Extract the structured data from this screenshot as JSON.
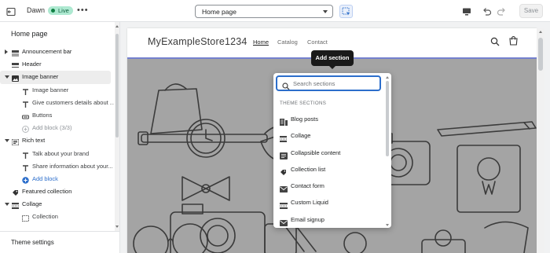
{
  "topbar": {
    "exit_icon": "exit-icon",
    "theme_name": "Dawn",
    "status_badge": "Live",
    "more_icon": "more-icon",
    "more_text": "•••",
    "page_selector": "Home page",
    "inspector_icon": "inspector-icon",
    "device_icon": "desktop-icon",
    "undo_icon": "undo-icon",
    "redo_icon": "redo-icon",
    "save_label": "Save"
  },
  "sidebar": {
    "title": "Home page",
    "items": [
      {
        "label": "Announcement bar",
        "level": 0,
        "arrow": "right",
        "icon": "announcement-icon"
      },
      {
        "label": "Header",
        "level": 0,
        "arrow": "",
        "icon": "header-icon"
      },
      {
        "label": "Image banner",
        "level": 0,
        "arrow": "down",
        "icon": "image-icon",
        "selected": true
      },
      {
        "label": "Image banner",
        "level": 1,
        "icon": "text-icon"
      },
      {
        "label": "Give customers details about ...",
        "level": 1,
        "icon": "text-icon"
      },
      {
        "label": "Buttons",
        "level": 1,
        "icon": "buttons-icon"
      },
      {
        "label": "Add block (3/3)",
        "level": 1,
        "icon": "add-disabled-icon",
        "muted": true
      },
      {
        "label": "Rich text",
        "level": 0,
        "arrow": "down",
        "icon": "rich-text-icon"
      },
      {
        "label": "Talk about your brand",
        "level": 1,
        "icon": "text-icon"
      },
      {
        "label": "Share information about your...",
        "level": 1,
        "icon": "text-icon"
      },
      {
        "label": "Add block",
        "level": 1,
        "icon": "add-icon",
        "link": true
      },
      {
        "label": "Featured collection",
        "level": 0,
        "arrow": "",
        "icon": "collection-tag-icon"
      },
      {
        "label": "Collage",
        "level": 0,
        "arrow": "down",
        "icon": "collage-icon"
      },
      {
        "label": "Collection",
        "level": 1,
        "icon": "collage-item-icon"
      }
    ],
    "footer_label": "Theme settings"
  },
  "preview": {
    "store_name": "MyExampleStore1234",
    "nav": [
      "Home",
      "Catalog",
      "Contact"
    ],
    "search_icon": "search-icon",
    "cart_icon": "cart-icon"
  },
  "tooltip": "Add section",
  "popup": {
    "search_placeholder": "Search sections",
    "search_value": "",
    "heading": "THEME SECTIONS",
    "items": [
      {
        "label": "Blog posts",
        "icon": "blog-icon"
      },
      {
        "label": "Collage",
        "icon": "collage-icon"
      },
      {
        "label": "Collapsible content",
        "icon": "collapsible-icon"
      },
      {
        "label": "Collection list",
        "icon": "collection-tag-icon"
      },
      {
        "label": "Contact form",
        "icon": "mail-icon"
      },
      {
        "label": "Custom Liquid",
        "icon": "custom-liquid-icon"
      },
      {
        "label": "Email signup",
        "icon": "mail-icon"
      }
    ]
  },
  "colors": {
    "accent": "#2c6ecb",
    "live_badge_bg": "#aee9d1",
    "banner_gray": "#a4a4a4",
    "highlight": "#5c6ac4"
  }
}
